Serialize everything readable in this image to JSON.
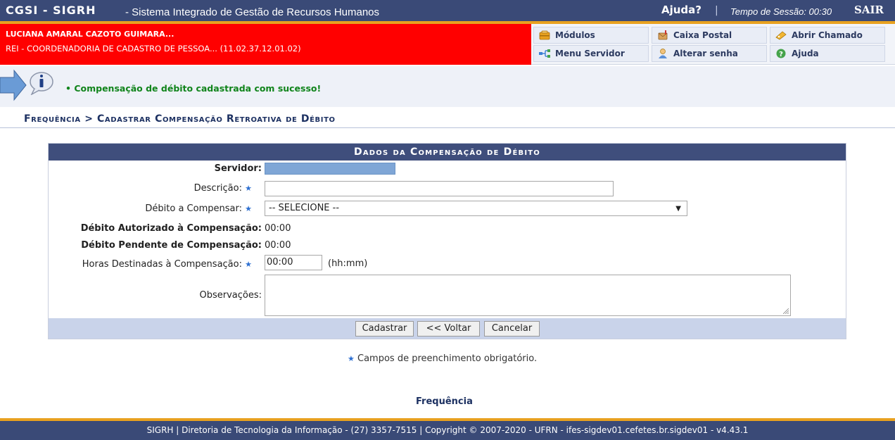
{
  "topbar": {
    "brand": "CGSI - SIGRH",
    "system_name": "- Sistema Integrado de Gestão de Recursos Humanos",
    "help": "Ajuda?",
    "separator": "|",
    "session_label": "Tempo de Sessão: 00:30",
    "exit": "SAIR"
  },
  "user": {
    "name": "LUCIANA AMARAL CAZOTO GUIMARA...",
    "department": "REI - COORDENADORIA DE CADASTRO DE PESSOA... (11.02.37.12.01.02)"
  },
  "menu": {
    "modulos": "Módulos",
    "caixa_postal": "Caixa Postal",
    "abrir_chamado": "Abrir Chamado",
    "menu_servidor": "Menu Servidor",
    "alterar_senha": "Alterar senha",
    "ajuda": "Ajuda"
  },
  "message": "• Compensação de débito cadastrada com sucesso!",
  "breadcrumb": "Frequência > Cadastrar Compensação Retroativa de Débito",
  "form": {
    "caption": "Dados da Compensação de Débito",
    "servidor_label": "Servidor:",
    "descricao_label": "Descrição:",
    "descricao_value": "",
    "debito_label": "Débito a Compensar:",
    "debito_selected": "-- SELECIONE --",
    "autorizado_label": "Débito Autorizado à Compensação:",
    "autorizado_value": "00:00",
    "pendente_label": "Débito Pendente de Compensação:",
    "pendente_value": "00:00",
    "horas_label": "Horas Destinadas à Compensação:",
    "horas_value": "00:00",
    "horas_hint": "(hh:mm)",
    "observacoes_label": "Observações:",
    "required_marker": "★"
  },
  "buttons": {
    "cadastrar": "Cadastrar",
    "voltar": "<< Voltar",
    "cancelar": "Cancelar"
  },
  "required_note": "Campos de preenchimento obrigatório.",
  "footer_link": "Frequência",
  "footer": "SIGRH | Diretoria de Tecnologia da Informação - (27) 3357-7515 | Copyright © 2007-2020 - UFRN - ifes-sigdev01.cefetes.br.sigdev01 - v4.43.1",
  "colors": {
    "topbar": "#3a4a77",
    "userbar": "#ff0000",
    "accent_gold": "#e8a11f",
    "success": "#10841b",
    "required_star": "#2d6fd1"
  },
  "icons": [
    "modules-icon",
    "mailbox-icon",
    "ticket-icon",
    "menu-servidor-icon",
    "password-icon",
    "help-icon",
    "info-icon",
    "arrow-pointer-icon"
  ]
}
